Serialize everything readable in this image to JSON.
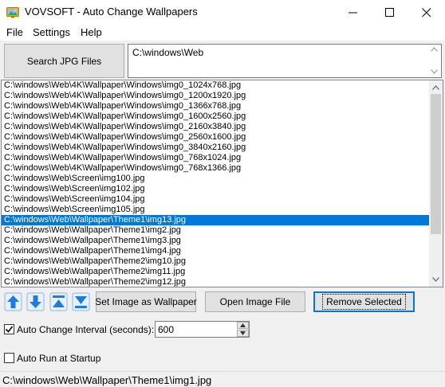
{
  "window": {
    "title": "VOVSOFT - Auto Change Wallpapers",
    "icon": "monitor-picture-icon"
  },
  "menu": [
    "File",
    "Settings",
    "Help"
  ],
  "search_button": "Search JPG Files",
  "search_path": "C:\\windows\\Web",
  "files": [
    "C:\\windows\\Web\\4K\\Wallpaper\\Windows\\img0_1024x768.jpg",
    "C:\\windows\\Web\\4K\\Wallpaper\\Windows\\img0_1200x1920.jpg",
    "C:\\windows\\Web\\4K\\Wallpaper\\Windows\\img0_1366x768.jpg",
    "C:\\windows\\Web\\4K\\Wallpaper\\Windows\\img0_1600x2560.jpg",
    "C:\\windows\\Web\\4K\\Wallpaper\\Windows\\img0_2160x3840.jpg",
    "C:\\windows\\Web\\4K\\Wallpaper\\Windows\\img0_2560x1600.jpg",
    "C:\\windows\\Web\\4K\\Wallpaper\\Windows\\img0_3840x2160.jpg",
    "C:\\windows\\Web\\4K\\Wallpaper\\Windows\\img0_768x1024.jpg",
    "C:\\windows\\Web\\4K\\Wallpaper\\Windows\\img0_768x1366.jpg",
    "C:\\windows\\Web\\Screen\\img100.jpg",
    "C:\\windows\\Web\\Screen\\img102.jpg",
    "C:\\windows\\Web\\Screen\\img104.jpg",
    "C:\\windows\\Web\\Screen\\img105.jpg",
    "C:\\windows\\Web\\Wallpaper\\Theme1\\img13.jpg",
    "C:\\windows\\Web\\Wallpaper\\Theme1\\img2.jpg",
    "C:\\windows\\Web\\Wallpaper\\Theme1\\img3.jpg",
    "C:\\windows\\Web\\Wallpaper\\Theme1\\img4.jpg",
    "C:\\windows\\Web\\Wallpaper\\Theme2\\img10.jpg",
    "C:\\windows\\Web\\Wallpaper\\Theme2\\img11.jpg",
    "C:\\windows\\Web\\Wallpaper\\Theme2\\img12.jpg"
  ],
  "selected_file": "C:\\windows\\Web\\Wallpaper\\Theme1\\img13.jpg",
  "nav_icons": [
    "move-up-icon",
    "move-down-icon",
    "move-top-icon",
    "move-bottom-icon"
  ],
  "actions": {
    "set_wallpaper": "Set Image as Wallpaper",
    "open_file": "Open Image File",
    "remove_selected": "Remove Selected"
  },
  "auto_change": {
    "label": "Auto Change Interval (seconds):",
    "checked": true,
    "value": "600"
  },
  "auto_run": {
    "label": "Auto Run at Startup",
    "checked": false
  },
  "status": "C:\\windows\\Web\\Wallpaper\\Theme1\\img1.jpg",
  "colors": {
    "selection": "#0078d7",
    "nav_icon": "#1e7be0"
  }
}
